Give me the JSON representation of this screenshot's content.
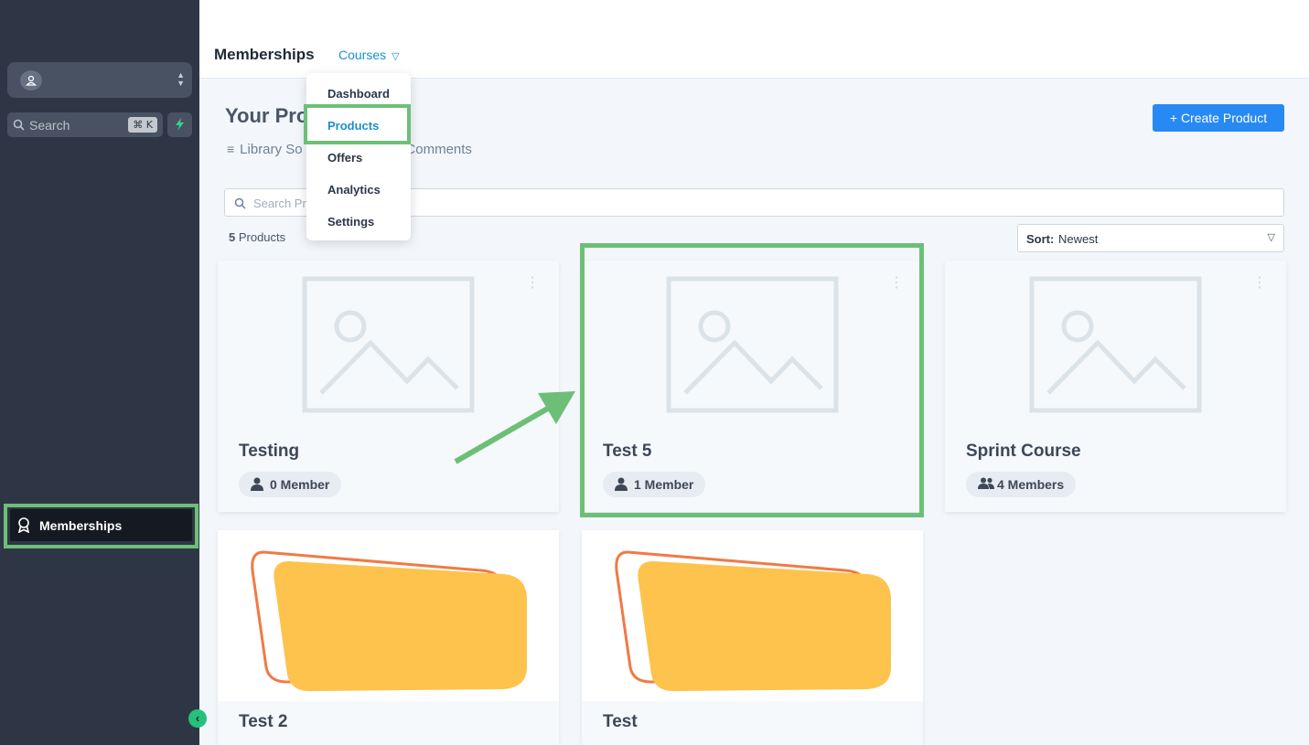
{
  "sidebar": {
    "search_placeholder": "Search",
    "search_shortcut": "⌘ K",
    "nav_item_label": "Memberships",
    "icons": {
      "avatar": "user-circle-icon",
      "search": "search-icon",
      "quick_action": "lightning-icon",
      "nav": "award-badge-icon",
      "collapse": "chevron-left-icon"
    }
  },
  "header": {
    "title": "Memberships",
    "courses_tab": "Courses"
  },
  "dropdown": {
    "items": [
      "Dashboard",
      "Products",
      "Offers",
      "Analytics",
      "Settings"
    ],
    "active": "Products"
  },
  "main": {
    "heading": "Your Pro",
    "subnav_left": "Library So",
    "subnav_right": "ge Comments",
    "create_button": "+ Create Product",
    "search_placeholder": "Search Pr",
    "product_count_number": "5",
    "product_count_label": " Products",
    "sort_label": "Sort:",
    "sort_value": "Newest"
  },
  "cards": [
    {
      "title": "Testing",
      "members": "0 Member"
    },
    {
      "title": "Test 5",
      "members": "1 Member"
    },
    {
      "title": "Sprint Course",
      "members": "4 Members"
    },
    {
      "title": "Test 2"
    },
    {
      "title": "Test"
    }
  ],
  "colors": {
    "sidebar_bg": "#2e3646",
    "accent_blue": "#2789f4",
    "link_blue": "#1a8fd0",
    "highlight_green": "#6dbf77",
    "thumb_orange": "#f07a45",
    "thumb_yellow": "#fdc34d"
  }
}
